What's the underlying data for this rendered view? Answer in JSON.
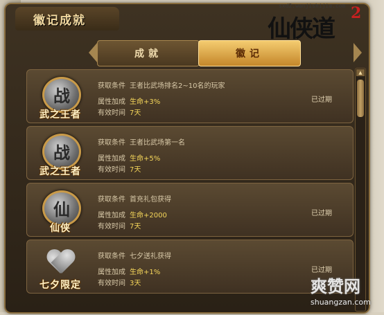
{
  "window": {
    "title": "徽记成就"
  },
  "logo": {
    "url": "sxd2.wanjishijia.com",
    "text": "仙侠道",
    "suffix": "2"
  },
  "tabs": [
    {
      "label": "成就"
    },
    {
      "label": "徽记"
    }
  ],
  "active_tab": "徽记",
  "field_labels": {
    "condition": "获取条件",
    "bonus": "属性加成",
    "duration": "有效时间"
  },
  "items": [
    {
      "badge_glyph": "战",
      "badge_name": "武之王者",
      "condition": "王者比武场排名2~10名的玩家",
      "bonus": "生命+3%",
      "duration": "7天",
      "status": "已过期"
    },
    {
      "badge_glyph": "战",
      "badge_name": "武之王者",
      "condition": "王者比武场第一名",
      "bonus": "生命+5%",
      "duration": "7天",
      "status": ""
    },
    {
      "badge_glyph": "仙",
      "badge_name": "仙侠",
      "condition": "首充礼包获得",
      "bonus": "生命+2000",
      "duration": "7天",
      "status": "已过期"
    },
    {
      "badge_glyph": "",
      "badge_name": "七夕限定",
      "condition": "七夕送礼获得",
      "bonus": "生命+1%",
      "duration": "3天",
      "status": "已过期"
    }
  ],
  "watermark": {
    "text": "爽赞网",
    "url": "shuangzan.com"
  },
  "colors": {
    "accent_gold": "#f4cc70",
    "value_yellow": "#f5d65a",
    "panel_dark": "#3e3222"
  }
}
